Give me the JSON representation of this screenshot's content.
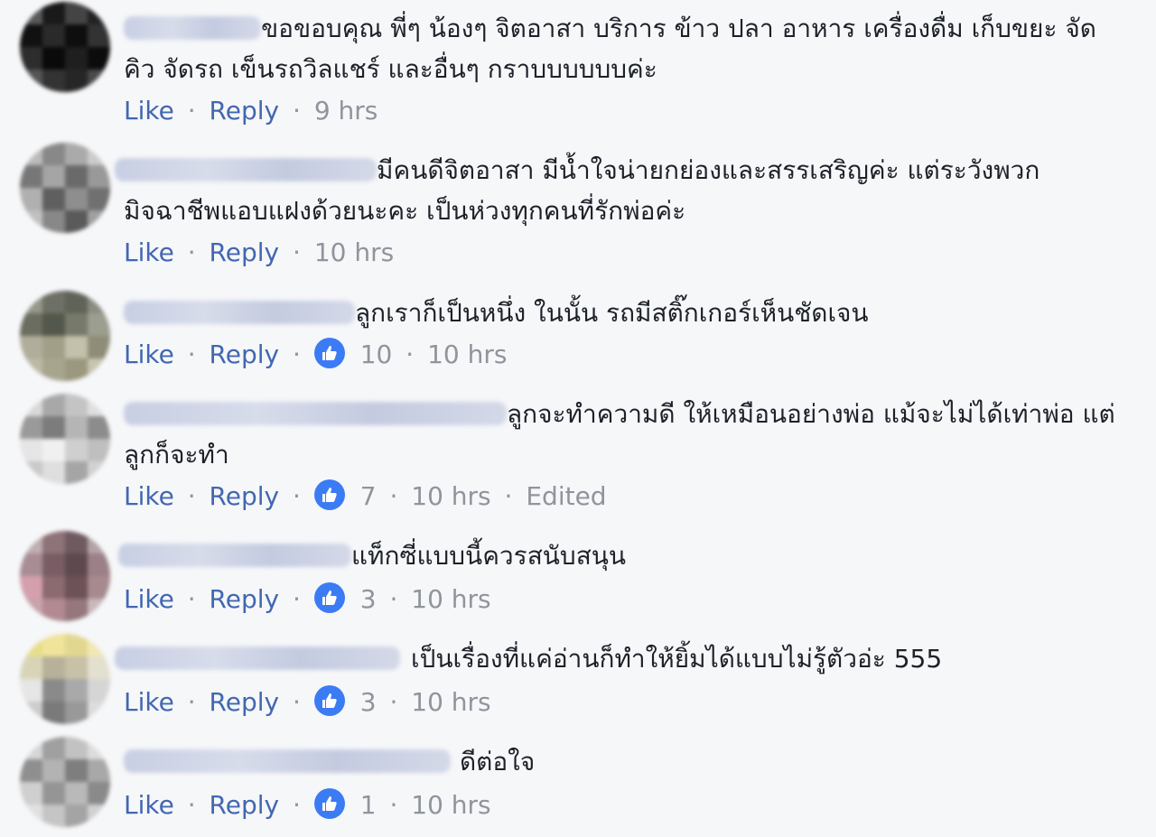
{
  "action_labels": {
    "like": "Like",
    "reply": "Reply",
    "separator": "·"
  },
  "comments": [
    {
      "text": "ขอขอบคุณ พี่ๆ น้องๆ จิตอาสา บริการ ข้าว ปลา อาหาร เครื่องดื่ม เก็บขยะ จัดคิว จัดรถ เข็นรถวิลแชร์ และอื่นๆ กราบบบบบบค่ะ",
      "time": "9 hrs"
    },
    {
      "text": "มีคนดีจิตอาสา มีน้ำใจน่ายกย่องและสรรเสริญค่ะ แต่ระวังพวกมิจฉาชีพแอบแฝงด้วยนะคะ เป็นห่วงทุกคนที่รักพ่อค่ะ",
      "time": "10 hrs"
    },
    {
      "text": "ลูกเราก็เป็นหนึ่ง ในนั้น รถมีสติ๊กเกอร์เห็นชัดเจน",
      "likes": "10",
      "time": "10 hrs"
    },
    {
      "text": "ลูกจะทำความดี ให้เหมือนอย่างพ่อ แม้จะไม่ได้เท่าพ่อ แต่ลูกก็จะทำ",
      "likes": "7",
      "time": "10 hrs",
      "edited": "Edited"
    },
    {
      "text": "แท็กซี่แบบนี้ควรสนับสนุน",
      "likes": "3",
      "time": "10 hrs"
    },
    {
      "text": "เป็นเรื่องที่แค่อ่านก็ทำให้ยิ้มได้แบบไม่รู้ตัวอ่ะ 555",
      "likes": "3",
      "time": "10 hrs"
    },
    {
      "text": "ดีต่อใจ",
      "likes": "1",
      "time": "10 hrs"
    }
  ],
  "colors": {
    "link": "#4267b2",
    "meta": "#90949c",
    "like_badge": "#3b7cf5",
    "background": "#f6f7f9"
  }
}
